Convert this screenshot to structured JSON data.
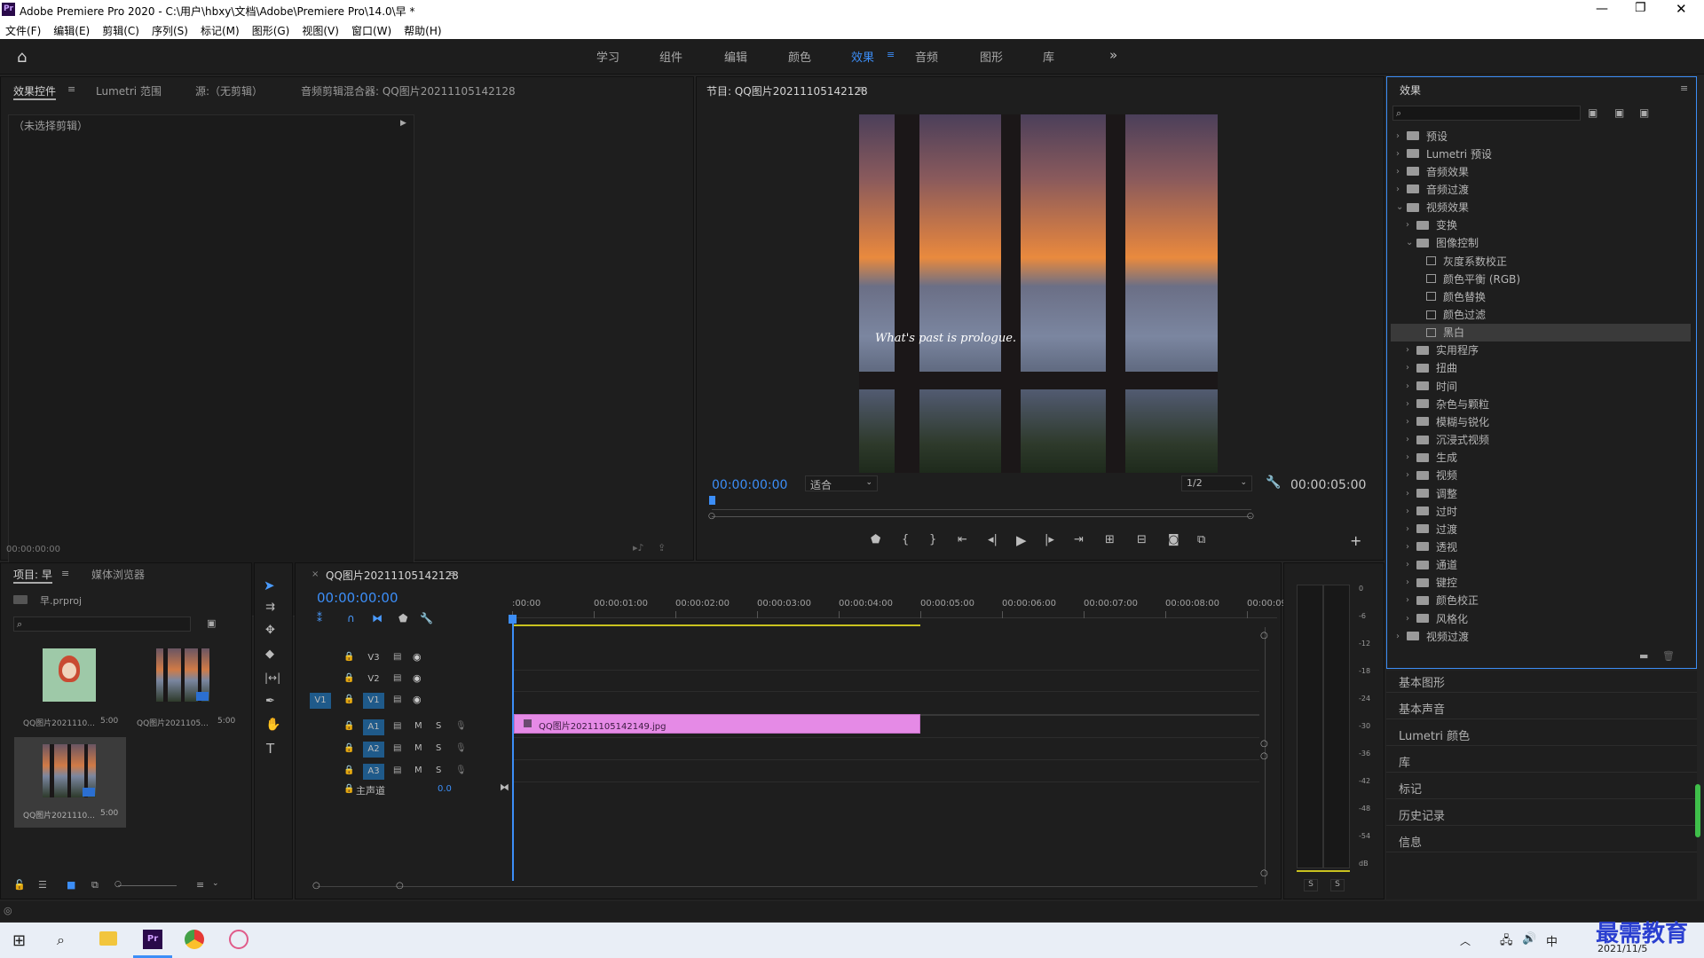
{
  "window": {
    "title": "Adobe Premiere Pro 2020 - C:\\用户\\hbxy\\文档\\Adobe\\Premiere Pro\\14.0\\早 *",
    "app_icon": "Pr"
  },
  "menu": [
    "文件(F)",
    "编辑(E)",
    "剪辑(C)",
    "序列(S)",
    "标记(M)",
    "图形(G)",
    "视图(V)",
    "窗口(W)",
    "帮助(H)"
  ],
  "workspaces": [
    "学习",
    "组件",
    "编辑",
    "颜色",
    "效果",
    "音频",
    "图形",
    "库"
  ],
  "active_workspace": "效果",
  "source_panel": {
    "tabs": [
      "效果控件",
      "Lumetri 范围",
      "源:（无剪辑）",
      "音频剪辑混合器: QQ图片20211105142128"
    ],
    "no_clip": "（未选择剪辑）",
    "timecode": "00:00:00:00"
  },
  "program": {
    "title": "节目: QQ图片20211105142128",
    "overlay_text": "What's past is prologue.",
    "timecode_left": "00:00:00:00",
    "fit": "适合",
    "resolution": "1/2",
    "timecode_right": "00:00:05:00"
  },
  "project": {
    "tabs": [
      "项目: 早",
      "媒体浏览器"
    ],
    "file": "早.prproj",
    "items": [
      {
        "name": "QQ图片2021110...",
        "duration": "5:00"
      },
      {
        "name": "QQ图片2021105...",
        "duration": "5:00"
      },
      {
        "name": "QQ图片2021110...",
        "duration": "5:00"
      }
    ]
  },
  "timeline": {
    "tab": "QQ图片20211105142128",
    "timecode": "00:00:00:00",
    "ruler": [
      ":00:00",
      "00:00:01:00",
      "00:00:02:00",
      "00:00:03:00",
      "00:00:04:00",
      "00:00:05:00",
      "00:00:06:00",
      "00:00:07:00",
      "00:00:08:00",
      "00:00:09:"
    ],
    "video_tracks": [
      "V3",
      "V2",
      "V1"
    ],
    "source_patch": "V1",
    "audio_tracks": [
      "A1",
      "A2",
      "A3"
    ],
    "master_label": "主声道",
    "master_value": "0.0",
    "clip_name": "QQ图片20211105142149.jpg",
    "mute": "M",
    "solo": "S"
  },
  "meter": {
    "scale": [
      "0",
      "-6",
      "-12",
      "-18",
      "-24",
      "-30",
      "-36",
      "-42",
      "-48",
      "-54",
      "dB"
    ],
    "solo_left": "S",
    "solo_right": "S"
  },
  "effects": {
    "title": "效果",
    "tree": [
      {
        "label": "预设",
        "level": 0,
        "kind": "folder",
        "open": false
      },
      {
        "label": "Lumetri 预设",
        "level": 0,
        "kind": "folder",
        "open": false
      },
      {
        "label": "音频效果",
        "level": 0,
        "kind": "folder",
        "open": false
      },
      {
        "label": "音频过渡",
        "level": 0,
        "kind": "folder",
        "open": false
      },
      {
        "label": "视频效果",
        "level": 0,
        "kind": "folder",
        "open": true
      },
      {
        "label": "变换",
        "level": 1,
        "kind": "folder",
        "open": false
      },
      {
        "label": "图像控制",
        "level": 1,
        "kind": "folder",
        "open": true
      },
      {
        "label": "灰度系数校正",
        "level": 2,
        "kind": "fx"
      },
      {
        "label": "颜色平衡 (RGB)",
        "level": 2,
        "kind": "fx"
      },
      {
        "label": "颜色替换",
        "level": 2,
        "kind": "fx"
      },
      {
        "label": "颜色过滤",
        "level": 2,
        "kind": "fx"
      },
      {
        "label": "黑白",
        "level": 2,
        "kind": "fx",
        "selected": true
      },
      {
        "label": "实用程序",
        "level": 1,
        "kind": "folder",
        "open": false
      },
      {
        "label": "扭曲",
        "level": 1,
        "kind": "folder",
        "open": false
      },
      {
        "label": "时间",
        "level": 1,
        "kind": "folder",
        "open": false
      },
      {
        "label": "杂色与颗粒",
        "level": 1,
        "kind": "folder",
        "open": false
      },
      {
        "label": "模糊与锐化",
        "level": 1,
        "kind": "folder",
        "open": false
      },
      {
        "label": "沉浸式视频",
        "level": 1,
        "kind": "folder",
        "open": false
      },
      {
        "label": "生成",
        "level": 1,
        "kind": "folder",
        "open": false
      },
      {
        "label": "视频",
        "level": 1,
        "kind": "folder",
        "open": false
      },
      {
        "label": "调整",
        "level": 1,
        "kind": "folder",
        "open": false
      },
      {
        "label": "过时",
        "level": 1,
        "kind": "folder",
        "open": false
      },
      {
        "label": "过渡",
        "level": 1,
        "kind": "folder",
        "open": false
      },
      {
        "label": "透视",
        "level": 1,
        "kind": "folder",
        "open": false
      },
      {
        "label": "通道",
        "level": 1,
        "kind": "folder",
        "open": false
      },
      {
        "label": "键控",
        "level": 1,
        "kind": "folder",
        "open": false
      },
      {
        "label": "颜色校正",
        "level": 1,
        "kind": "folder",
        "open": false
      },
      {
        "label": "风格化",
        "level": 1,
        "kind": "folder",
        "open": false
      },
      {
        "label": "视频过渡",
        "level": 0,
        "kind": "folder",
        "open": false
      }
    ]
  },
  "side_panels": [
    "基本图形",
    "基本声音",
    "Lumetri 颜色",
    "库",
    "标记",
    "历史记录",
    "信息"
  ],
  "taskbar": {
    "date": "2021/11/5",
    "ime": "中",
    "watermark": "最需教育"
  }
}
